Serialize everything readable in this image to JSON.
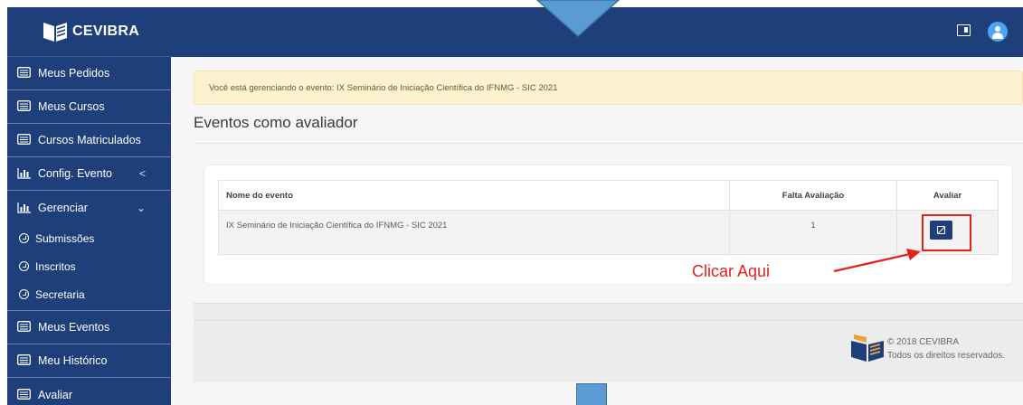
{
  "brand": {
    "name": "CEVIBRA"
  },
  "sidebar": {
    "items": [
      {
        "label": "Meus Pedidos",
        "icon": "list-icon"
      },
      {
        "label": "Meus Cursos",
        "icon": "list-icon"
      },
      {
        "label": "Cursos Matriculados",
        "icon": "list-icon"
      },
      {
        "label": "Config. Evento",
        "icon": "bar-chart-icon",
        "chevron": "<"
      },
      {
        "label": "Gerenciar",
        "icon": "bar-chart-icon",
        "chevron": "⌄"
      },
      {
        "label": "Meus Eventos",
        "icon": "list-icon"
      },
      {
        "label": "Meu Histórico",
        "icon": "list-icon"
      },
      {
        "label": "Avaliar",
        "icon": "list-icon"
      }
    ],
    "subitems": [
      {
        "label": "Submissões"
      },
      {
        "label": "Inscritos"
      },
      {
        "label": "Secretaria"
      }
    ]
  },
  "alert": {
    "text": "Você está gerenciando o evento: IX Seminário de Iniciação Científica do IFNMG - SIC 2021"
  },
  "main": {
    "title": "Eventos como avaliador"
  },
  "table": {
    "headers": [
      "Nome do evento",
      "Falta Avaliação",
      "Avaliar"
    ],
    "rows": [
      {
        "name": "IX Seminário de Iniciação Científica do IFNMG - SIC 2021",
        "pending": "1",
        "action_icon": "edit-icon"
      }
    ]
  },
  "annotation": {
    "text": "Clicar Aqui",
    "color": "#e3221c"
  },
  "footer": {
    "copyright": "© 2018 CEVIBRA",
    "rights": "Todos os direitos reservados."
  },
  "colors": {
    "primary": "#1f3f7a",
    "alert_bg": "#fdf2cf",
    "annotation": "#e3221c",
    "overlay_arrow": "#5b9bd5"
  }
}
